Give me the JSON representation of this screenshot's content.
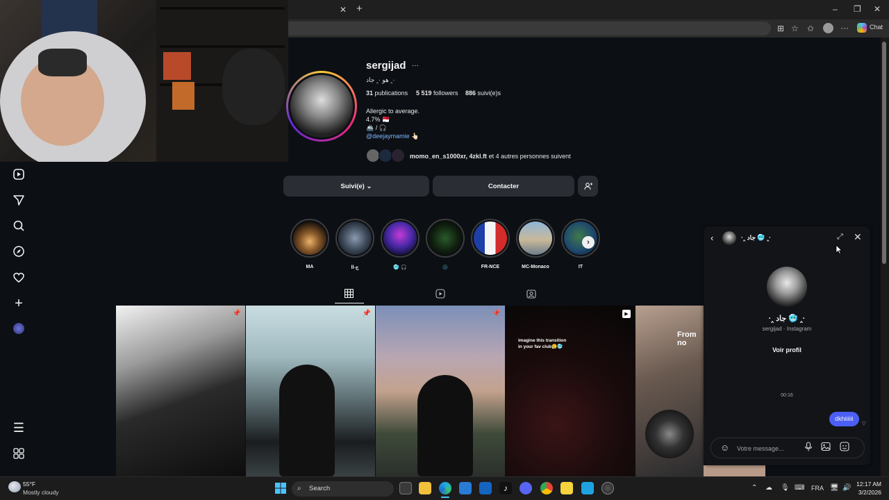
{
  "browser": {
    "chat_label": "Chat"
  },
  "profile": {
    "username": "sergijad",
    "more": "···",
    "display_name": "هو ·‸ جاد ‸·",
    "publications_count": "31",
    "publications_label": "publications",
    "followers_count": "5 519",
    "followers_label": "followers",
    "following_count": "886",
    "following_label": "suivi(e)s",
    "bio_line1": "Allergic to average.",
    "bio_line2": "4.7% 🇲🇨",
    "bio_line3": "🚢 / 🎧",
    "bio_link": "@deejaymamie 👆🏻",
    "mutuals_names": "momo_en_s1000xr, 4zkl.ft",
    "mutuals_suffix": "et 4 autres personnes suivent"
  },
  "actions": {
    "following_label": "Suivi(e) ⌄",
    "contact_label": "Contacter"
  },
  "highlights": [
    {
      "label": "MA"
    },
    {
      "label": "ll-ج"
    },
    {
      "label": "🥶 🎧"
    },
    {
      "label": "🌑"
    },
    {
      "label": "FR-NCE"
    },
    {
      "label": "MC-Monaco"
    },
    {
      "label": "IT"
    }
  ],
  "posts": {
    "post4_caption": "imagine this transition in your fav club😮‍💨🥶",
    "post5_caption": "From no"
  },
  "chat": {
    "header_name": "·‸ جاد 🥶 ‸·",
    "profile_name": "·‸ جاد 🥶 ‸·",
    "profile_sub": "sergijad · Instagram",
    "view_profile": "Voir profil",
    "timestamp": "00:16",
    "message": "dkhiiiiii",
    "input_placeholder": "Votre message..."
  },
  "taskbar": {
    "weather_temp": "55°F",
    "weather_desc": "Mostly cloudy",
    "search_label": "Search",
    "lang": "FRA",
    "time": "12:17 AM",
    "date": "3/2/2026"
  }
}
